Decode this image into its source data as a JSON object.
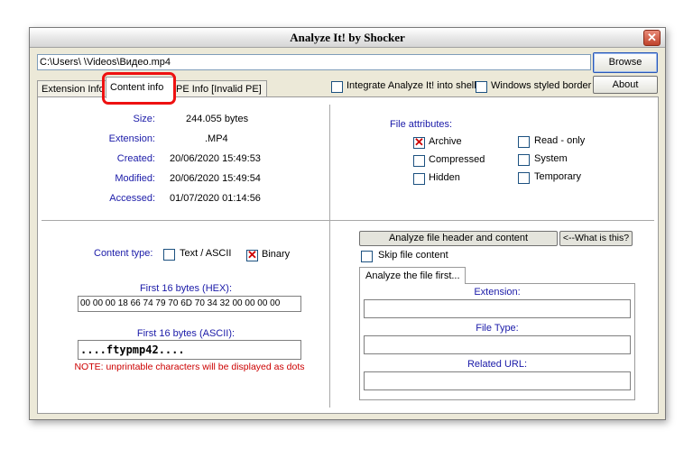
{
  "window": {
    "title": "Analyze It! by Shocker",
    "close_symbol": "✕"
  },
  "path": {
    "value": "C:\\Users\\       \\Videos\\Видео.mp4"
  },
  "buttons": {
    "browse": "Browse",
    "about": "About",
    "analyze": "Analyze file header and content",
    "what_is_this": "<--What is this?"
  },
  "tabs": {
    "extension_info": "Extension Info",
    "content_info": "Content info",
    "pe_info": "PE Info [Invalid PE]"
  },
  "options": {
    "integrate_shell": "Integrate Analyze It! into shell",
    "windows_border": "Windows styled border"
  },
  "file_info": {
    "size_label": "Size:",
    "size_value": "244.055 bytes",
    "extension_label": "Extension:",
    "extension_value": ".MP4",
    "created_label": "Created:",
    "created_value": "20/06/2020 15:49:53",
    "modified_label": "Modified:",
    "modified_value": "20/06/2020 15:49:54",
    "accessed_label": "Accessed:",
    "accessed_value": "01/07/2020 01:14:56"
  },
  "attributes": {
    "title": "File attributes:",
    "archive": "Archive",
    "compressed": "Compressed",
    "hidden": "Hidden",
    "readonly": "Read - only",
    "system": "System",
    "temporary": "Temporary"
  },
  "content": {
    "type_label": "Content type:",
    "text_ascii": "Text / ASCII",
    "binary": "Binary",
    "hex_label": "First 16 bytes (HEX):",
    "hex_value": "00 00 00 18 66 74 79 70 6D 70 34 32 00 00 00 00",
    "ascii_label": "First 16 bytes (ASCII):",
    "ascii_value": "....ftypmp42....",
    "note": "NOTE: unprintable characters will be displayed as dots"
  },
  "analyze": {
    "skip_label": "Skip file content",
    "subtab": "Analyze the file first...",
    "extension_label": "Extension:",
    "filetype_label": "File Type:",
    "url_label": "Related URL:"
  }
}
